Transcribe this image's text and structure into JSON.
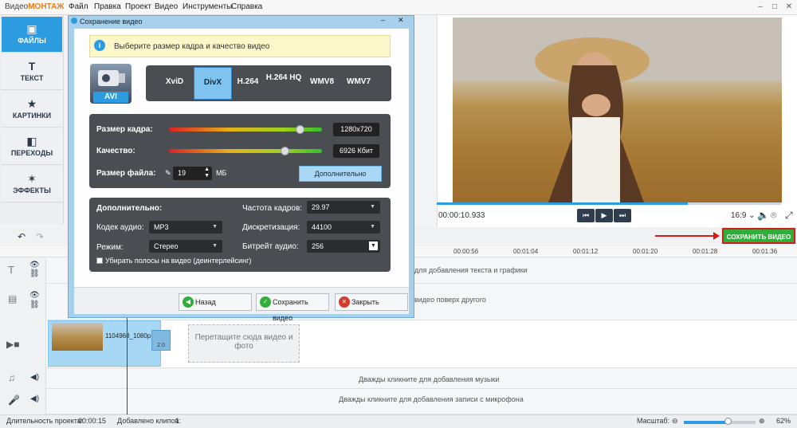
{
  "app": {
    "title_prefix": "Видео",
    "title_brand": "МОНТАЖ"
  },
  "menu": [
    "Файл",
    "Правка",
    "Проект",
    "Видео",
    "Инструменты",
    "Справка"
  ],
  "window_controls": {
    "minimize": "–",
    "maximize": "□",
    "close": "✕"
  },
  "left_tabs": [
    {
      "label": "ФАЙЛЫ",
      "icon": "folder-icon",
      "glyph": "▣"
    },
    {
      "label": "ТЕКСТ",
      "icon": "text-icon",
      "glyph": "T"
    },
    {
      "label": "КАРТИНКИ",
      "icon": "star-icon",
      "glyph": "★"
    },
    {
      "label": "ПЕРЕХОДЫ",
      "icon": "transitions-icon",
      "glyph": "◧"
    },
    {
      "label": "ЭФФЕКТЫ",
      "icon": "wand-icon",
      "glyph": "✶"
    }
  ],
  "dialog": {
    "title": "Сохранение видео",
    "hint": "Выберите размер кадра и качество видео",
    "format_label": "AVI",
    "codecs": [
      {
        "label": "XviD",
        "selected": false
      },
      {
        "label": "DivX",
        "selected": true
      },
      {
        "label": "H.264",
        "selected": false
      },
      {
        "label": "H.264 HQ",
        "selected": false
      },
      {
        "label": "WMV8",
        "selected": false
      },
      {
        "label": "WMV7",
        "selected": false
      }
    ],
    "frame_size": {
      "label": "Размер кадра:",
      "value": "1280x720",
      "level": 0.86
    },
    "quality": {
      "label": "Качество:",
      "value": "6926 Кбит",
      "level": 0.76
    },
    "file_size": {
      "label": "Размер файла:",
      "value": "19",
      "unit": "МБ"
    },
    "more_button": "Дополнительно",
    "advanced": {
      "title": "Дополнительно:",
      "audio_codec": {
        "label": "Кодек аудио:",
        "value": "MP3"
      },
      "mode": {
        "label": "Режим:",
        "value": "Стерео"
      },
      "frame_rate": {
        "label": "Частота кадров:",
        "value": "29.97"
      },
      "sampling": {
        "label": "Дискретизация:",
        "value": "44100"
      },
      "audio_bitrate": {
        "label": "Битрейт аудио:",
        "value": "256"
      },
      "deinterlace": {
        "label": "Убирать полосы на видео (деинтерлейсинг)",
        "checked": false
      }
    },
    "buttons": {
      "back": "Назад",
      "save": "Сохранить видео",
      "close": "Закрыть"
    }
  },
  "player": {
    "time": "00:00:10.933",
    "aspect": "16:9",
    "progress": 0.73
  },
  "save_video_button": "СОХРАНИТЬ ВИДЕО",
  "ruler_ticks": [
    "00:00:56",
    "00:01:04",
    "00:01:12",
    "00:01:20",
    "00:01:28",
    "00:01:36"
  ],
  "tracks": {
    "text_hint": "для добавления текста и графики",
    "overlay_hint": "видео поверх другого",
    "clip_name": "1104968_1080p",
    "clip_transition": "2.0",
    "drop_zone": "Перетащите сюда видео и фото",
    "music_hint": "Дважды кликните для добавления музыки",
    "mic_hint": "Дважды кликните для добавления записи с микрофона"
  },
  "status": {
    "duration_label": "Длительность проекта:",
    "duration_value": "00:00:15",
    "clips_label": "Добавлено клипов:",
    "clips_value": "1",
    "zoom_label": "Масштаб:",
    "zoom_value": "62%",
    "zoom_level": 0.62
  }
}
